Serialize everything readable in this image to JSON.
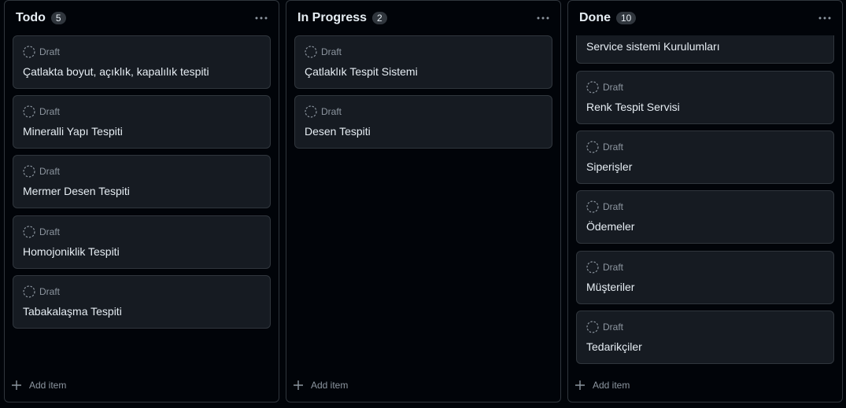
{
  "columns": [
    {
      "title": "Todo",
      "count": "5",
      "add_label": "Add item",
      "cards": [
        {
          "status": "Draft",
          "title": "Çatlakta boyut, açıklık, kapalılık tespiti"
        },
        {
          "status": "Draft",
          "title": "Mineralli Yapı Tespiti"
        },
        {
          "status": "Draft",
          "title": "Mermer Desen Tespiti"
        },
        {
          "status": "Draft",
          "title": "Homojoniklik Tespiti"
        },
        {
          "status": "Draft",
          "title": "Tabakalaşma Tespiti"
        }
      ]
    },
    {
      "title": "In Progress",
      "count": "2",
      "add_label": "Add item",
      "cards": [
        {
          "status": "Draft",
          "title": "Çatlaklık Tespit Sistemi"
        },
        {
          "status": "Draft",
          "title": "Desen Tespiti"
        }
      ]
    },
    {
      "title": "Done",
      "count": "10",
      "add_label": "Add item",
      "cards": [
        {
          "status": "",
          "title": "Service sistemi Kurulumları"
        },
        {
          "status": "Draft",
          "title": "Renk Tespit Servisi"
        },
        {
          "status": "Draft",
          "title": "Siperişler"
        },
        {
          "status": "Draft",
          "title": "Ödemeler"
        },
        {
          "status": "Draft",
          "title": "Müşteriler"
        },
        {
          "status": "Draft",
          "title": "Tedarikçiler"
        }
      ]
    }
  ],
  "colors": {
    "background": "#010409",
    "card": "#161b22",
    "border": "#30363d",
    "muted": "#8d96a0"
  }
}
